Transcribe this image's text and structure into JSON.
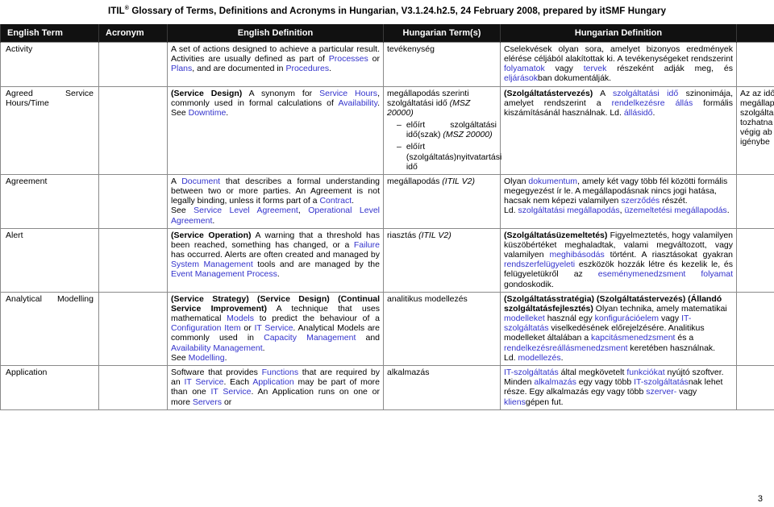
{
  "document": {
    "header_prefix": "ITIL",
    "header_mark": "®",
    "header_rest": " Glossary of Terms, Definitions and Acronyms in Hungarian, V3.1.24.h2.5, 24 February 2008, prepared by itSMF Hungary",
    "page_number": "3",
    "link_color": "#3333CC",
    "header_bg": "#111111"
  },
  "table": {
    "columns": [
      {
        "key": "english_term",
        "label": "English Term"
      },
      {
        "key": "acronym",
        "label": "Acronym"
      },
      {
        "key": "english_definition",
        "label": "English Definition"
      },
      {
        "key": "hungarian_term",
        "label": "Hungarian Term(s)"
      },
      {
        "key": "hungarian_definition",
        "label": "Hungarian Definition"
      },
      {
        "key": "overflow",
        "label": ""
      }
    ],
    "rows": [
      {
        "english_term": "Activity",
        "acronym": "",
        "english_definition": {
          "segments": [
            {
              "t": "A set of actions designed to achieve a particular result. Activities are usually defined as part of "
            },
            {
              "t": "Processes",
              "s": "link"
            },
            {
              "t": " or "
            },
            {
              "t": "Plans",
              "s": "link"
            },
            {
              "t": ", and are documented in "
            },
            {
              "t": "Procedures",
              "s": "link"
            },
            {
              "t": "."
            }
          ]
        },
        "hungarian_term": {
          "segments": [
            {
              "t": "tevékenység"
            }
          ]
        },
        "hungarian_definition": {
          "segments": [
            {
              "t": "Cselekvések olyan sora, amelyet bizonyos eredmények elérése céljából alakítottak ki. A tevékenységeket rendszerint "
            },
            {
              "t": "folyamatok",
              "s": "link"
            },
            {
              "t": " vagy "
            },
            {
              "t": "tervek",
              "s": "link"
            },
            {
              "t": " részeként adják meg, és "
            },
            {
              "t": "eljárások",
              "s": "link"
            },
            {
              "t": "ban dokumentálják."
            }
          ]
        },
        "overflow": {
          "segments": []
        }
      },
      {
        "english_term": "Agreed Service Hours/Time",
        "acronym": "",
        "english_definition": {
          "segments": [
            {
              "t": "(Service Design)",
              "s": "bold"
            },
            {
              "t": " A synonym for "
            },
            {
              "t": "Service Hours",
              "s": "link"
            },
            {
              "t": ", commonly used in formal calculations of "
            },
            {
              "t": "Availability",
              "s": "link"
            },
            {
              "t": ". See "
            },
            {
              "t": "Downtime",
              "s": "link"
            },
            {
              "t": "."
            }
          ]
        },
        "hungarian_term": {
          "segments": [
            {
              "t": "megállapodás szerinti szolgáltatási idő "
            },
            {
              "t": "(MSZ 20000)",
              "s": "italic"
            }
          ],
          "subitems": [
            {
              "dash": "–",
              "segments": [
                {
                  "t": "előírt szolgáltatási idő(szak) "
                },
                {
                  "t": "(MSZ 20000)",
                  "s": "italic"
                }
              ]
            },
            {
              "dash": "–",
              "segments": [
                {
                  "t": "előírt (szolgáltatás)nyitvatartási idő"
                }
              ]
            }
          ]
        },
        "hungarian_definition": {
          "segments": [
            {
              "t": "(Szolgáltatástervezés)",
              "s": "bold"
            },
            {
              "t": " A "
            },
            {
              "t": "szolgáltatási idő",
              "s": "link"
            },
            {
              "t": " szinonimája, amelyet rendszerint a "
            },
            {
              "t": "rendelkezésre állás",
              "s": "link"
            },
            {
              "t": " formális kiszámításánál használnak. Ld. "
            },
            {
              "t": "állásidő",
              "s": "link"
            },
            {
              "t": "."
            }
          ]
        },
        "overflow": {
          "segments": [
            {
              "t": "Az az idő"
            },
            {
              "t": "megállap"
            },
            {
              "t": "szolgálta"
            },
            {
              "t": "tozhatna"
            },
            {
              "t": "végig ab"
            },
            {
              "t": "igénybe"
            }
          ]
        }
      },
      {
        "english_term": "Agreement",
        "acronym": "",
        "english_definition": {
          "segments": [
            {
              "t": "A "
            },
            {
              "t": "Document",
              "s": "link"
            },
            {
              "t": " that describes a formal understanding between two or more parties. An Agreement is not legally binding, unless it forms part of a "
            },
            {
              "t": "Contract",
              "s": "link"
            },
            {
              "t": "."
            }
          ],
          "second_paragraph": [
            {
              "t": "See "
            },
            {
              "t": "Service Level Agreement",
              "s": "link"
            },
            {
              "t": ", "
            },
            {
              "t": "Operational Level Agreement",
              "s": "link"
            },
            {
              "t": "."
            }
          ]
        },
        "hungarian_term": {
          "segments": [
            {
              "t": "megállapodás "
            },
            {
              "t": "(ITIL V2)",
              "s": "italic"
            }
          ]
        },
        "hungarian_definition": {
          "segments": [
            {
              "t": "Olyan "
            },
            {
              "t": "dokumentum",
              "s": "link"
            },
            {
              "t": ", amely két vagy több fél közötti formális megegyezést ír le. A megállapodásnak nincs jogi hatása, hacsak nem képezi valamilyen "
            },
            {
              "t": "szerződés",
              "s": "link"
            },
            {
              "t": " részét."
            }
          ],
          "second_paragraph": [
            {
              "t": "Ld. "
            },
            {
              "t": "szolgáltatási megállapodás",
              "s": "link"
            },
            {
              "t": ", "
            },
            {
              "t": "üzemeltetési megállapodás",
              "s": "link"
            },
            {
              "t": "."
            }
          ]
        },
        "overflow": {
          "segments": []
        }
      },
      {
        "english_term": "Alert",
        "acronym": "",
        "english_definition": {
          "segments": [
            {
              "t": "(Service Operation)",
              "s": "bold"
            },
            {
              "t": " A warning that a threshold has been reached, something has changed, or a "
            },
            {
              "t": "Failure",
              "s": "link"
            },
            {
              "t": " has occurred. Alerts are often created and managed by "
            },
            {
              "t": "System Management",
              "s": "link"
            },
            {
              "t": " tools and are managed by the "
            },
            {
              "t": "Event Management Process",
              "s": "link"
            },
            {
              "t": "."
            }
          ]
        },
        "hungarian_term": {
          "segments": [
            {
              "t": "riasztás "
            },
            {
              "t": "(ITIL V2)",
              "s": "italic"
            }
          ]
        },
        "hungarian_definition": {
          "segments": [
            {
              "t": "(Szolgáltatásüzemeltetés)",
              "s": "bold"
            },
            {
              "t": " Figyelmeztetés, hogy valamilyen küszöbértéket meghaladtak, valami megváltozott, vagy valamilyen "
            },
            {
              "t": "meghibásodás",
              "s": "link"
            },
            {
              "t": " történt. A riasztásokat gyakran "
            },
            {
              "t": "rendszerfelügyeleti",
              "s": "link"
            },
            {
              "t": " eszközök hozzák létre és kezelik le, és felügyeletükről az "
            },
            {
              "t": "eseménymenedzsment folyamat",
              "s": "link"
            },
            {
              "t": " gondoskodik."
            }
          ]
        },
        "overflow": {
          "segments": []
        }
      },
      {
        "english_term": "Analytical Modelling",
        "acronym": "",
        "english_definition": {
          "segments": [
            {
              "t": "(Service Strategy) (Service Design) (Continual Service Improvement)",
              "s": "bold"
            },
            {
              "t": " A technique that uses mathematical "
            },
            {
              "t": "Models",
              "s": "link"
            },
            {
              "t": " to predict the behaviour of a "
            },
            {
              "t": "Configuration Item",
              "s": "link"
            },
            {
              "t": " or "
            },
            {
              "t": "IT Service",
              "s": "link"
            },
            {
              "t": ". Analytical Models are commonly used in "
            },
            {
              "t": "Capacity Management",
              "s": "link"
            },
            {
              "t": " and "
            },
            {
              "t": "Availability Management",
              "s": "link"
            },
            {
              "t": "."
            }
          ],
          "second_paragraph": [
            {
              "t": "See "
            },
            {
              "t": "Modelling",
              "s": "link"
            },
            {
              "t": "."
            }
          ]
        },
        "hungarian_term": {
          "segments": [
            {
              "t": "analitikus modellezés"
            }
          ]
        },
        "hungarian_definition": {
          "segments": [
            {
              "t": "(Szolgáltatásstratégia) (Szolgáltatástervezés) (Állandó szolgáltatásfejlesztés)",
              "s": "bold"
            },
            {
              "t": " Olyan technika, amely matematikai "
            },
            {
              "t": "modelleket",
              "s": "link"
            },
            {
              "t": " használ egy "
            },
            {
              "t": "konfigurációelem",
              "s": "link"
            },
            {
              "t": " vagy "
            },
            {
              "t": "IT-szolgáltatás",
              "s": "link"
            },
            {
              "t": " viselkedésének előrejelzésére. Analitikus modelleket általában a "
            },
            {
              "t": "kapcitásmenedzsment",
              "s": "link"
            },
            {
              "t": " és a "
            },
            {
              "t": "rendelkezésreállásmenedzsment",
              "s": "link"
            },
            {
              "t": " keretében használnak."
            }
          ],
          "second_paragraph": [
            {
              "t": "Ld. "
            },
            {
              "t": "modellezés",
              "s": "link"
            },
            {
              "t": "."
            }
          ]
        },
        "overflow": {
          "segments": []
        }
      },
      {
        "english_term": "Application",
        "acronym": "",
        "english_definition": {
          "segments": [
            {
              "t": "Software that provides "
            },
            {
              "t": "Functions",
              "s": "link"
            },
            {
              "t": " that are required by an "
            },
            {
              "t": "IT Service",
              "s": "link"
            },
            {
              "t": ". Each "
            },
            {
              "t": "Application",
              "s": "link"
            },
            {
              "t": " may be part of more than one "
            },
            {
              "t": "IT Service",
              "s": "link"
            },
            {
              "t": ". An Application runs on one or more "
            },
            {
              "t": "Servers",
              "s": "link"
            },
            {
              "t": " or"
            }
          ]
        },
        "hungarian_term": {
          "segments": [
            {
              "t": "alkalmazás"
            }
          ]
        },
        "hungarian_definition": {
          "segments": [
            {
              "t": "IT-szolgáltatás",
              "s": "link"
            },
            {
              "t": " által megkövetelt "
            },
            {
              "t": "funkciókat",
              "s": "link"
            },
            {
              "t": " nyújtó szoftver. Minden "
            },
            {
              "t": "alkalmazás",
              "s": "link"
            },
            {
              "t": " egy vagy több "
            },
            {
              "t": "IT-szolgáltatás",
              "s": "link"
            },
            {
              "t": "nak lehet része. Egy alkalmazás egy vagy több "
            },
            {
              "t": "szerver-",
              "s": "link"
            },
            {
              "t": " vagy "
            },
            {
              "t": "kliens",
              "s": "link"
            },
            {
              "t": "gépen fut."
            }
          ]
        },
        "overflow": {
          "segments": []
        }
      }
    ]
  }
}
